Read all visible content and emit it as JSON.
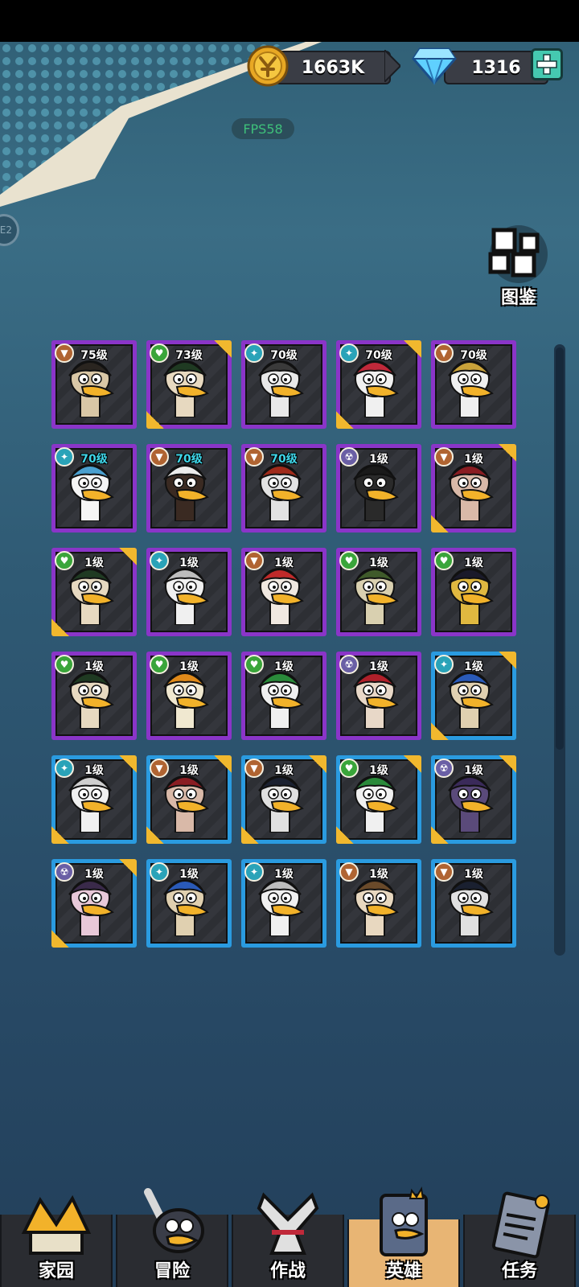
{
  "header": {
    "gold": "1663K",
    "gems": "1316",
    "fps": "FPS58",
    "side_button_text": "E2"
  },
  "codex": {
    "label": "图鉴"
  },
  "colors": {
    "purple_frame": "#8a35c8",
    "blue_frame": "#2a9be0",
    "gold_corner": "#f1b82e",
    "active_tab": "#e8b574"
  },
  "heroes": [
    {
      "level": "75级",
      "cls": "tank",
      "frame": "purple",
      "gold": false,
      "cyan": false,
      "hat": "dark",
      "face": "#d9c7a6"
    },
    {
      "level": "73级",
      "cls": "heal",
      "frame": "purple",
      "gold": true,
      "cyan": false,
      "hat": "#1f3a22",
      "face": "#e7d9c0"
    },
    {
      "level": "70级",
      "cls": "dps",
      "frame": "purple",
      "gold": false,
      "cyan": false,
      "hat": "#3a3a3a",
      "face": "#e8e8e8"
    },
    {
      "level": "70级",
      "cls": "dps",
      "frame": "purple",
      "gold": true,
      "cyan": false,
      "hat": "#c0293a",
      "face": "#f0f0f0"
    },
    {
      "level": "70级",
      "cls": "tank",
      "frame": "purple",
      "gold": false,
      "cyan": false,
      "hat": "#c9a23a",
      "face": "#efefef"
    },
    {
      "level": "70级",
      "cls": "dps",
      "frame": "purple",
      "gold": false,
      "cyan": true,
      "hat": "#4aa0d0",
      "face": "#f5f5f5"
    },
    {
      "level": "70级",
      "cls": "tank",
      "frame": "purple",
      "gold": false,
      "cyan": true,
      "hat": "#ececec",
      "face": "#3a2a22"
    },
    {
      "level": "70级",
      "cls": "tank",
      "frame": "purple",
      "gold": false,
      "cyan": true,
      "hat": "#a02a1a",
      "face": "#e2e2e2"
    },
    {
      "level": "1级",
      "cls": "mage",
      "frame": "purple",
      "gold": false,
      "cyan": false,
      "hat": "#1a1a1a",
      "face": "#2a2a2a"
    },
    {
      "level": "1级",
      "cls": "tank",
      "frame": "purple",
      "gold": true,
      "cyan": false,
      "hat": "#8a1d22",
      "face": "#d9b9a8"
    },
    {
      "level": "1级",
      "cls": "heal",
      "frame": "purple",
      "gold": true,
      "cyan": false,
      "hat": "#1f3a22",
      "face": "#e7d9c0"
    },
    {
      "level": "1级",
      "cls": "dps",
      "frame": "purple",
      "gold": false,
      "cyan": false,
      "hat": "#bdbdbd",
      "face": "#f0f0f0"
    },
    {
      "level": "1级",
      "cls": "tank",
      "frame": "purple",
      "gold": false,
      "cyan": false,
      "hat": "#c02a2a",
      "face": "#f0e8e0"
    },
    {
      "level": "1级",
      "cls": "heal",
      "frame": "purple",
      "gold": false,
      "cyan": false,
      "hat": "#3f5a2a",
      "face": "#d9d0b0"
    },
    {
      "level": "1级",
      "cls": "heal",
      "frame": "purple",
      "gold": false,
      "cyan": false,
      "hat": "#1a1a2a",
      "face": "#e0b840"
    },
    {
      "level": "1级",
      "cls": "heal",
      "frame": "purple",
      "gold": false,
      "cyan": false,
      "hat": "#1f3a22",
      "face": "#e7d9c0"
    },
    {
      "level": "1级",
      "cls": "heal",
      "frame": "purple",
      "gold": false,
      "cyan": false,
      "hat": "#e08a1a",
      "face": "#f0e8d0"
    },
    {
      "level": "1级",
      "cls": "heal",
      "frame": "purple",
      "gold": false,
      "cyan": false,
      "hat": "#2a8a3a",
      "face": "#f0f0f0"
    },
    {
      "level": "1级",
      "cls": "mage",
      "frame": "purple",
      "gold": false,
      "cyan": false,
      "hat": "#b0202a",
      "face": "#e8d8c8"
    },
    {
      "level": "1级",
      "cls": "dps",
      "frame": "blue",
      "gold": true,
      "cyan": false,
      "hat": "#2a5ab8",
      "face": "#e0d0b0"
    },
    {
      "level": "1级",
      "cls": "dps",
      "frame": "blue",
      "gold": true,
      "cyan": false,
      "hat": "#cfcfcf",
      "face": "#f0f0f0"
    },
    {
      "level": "1级",
      "cls": "tank",
      "frame": "blue",
      "gold": true,
      "cyan": false,
      "hat": "#8a1d22",
      "face": "#d9b9a8"
    },
    {
      "level": "1级",
      "cls": "tank",
      "frame": "blue",
      "gold": true,
      "cyan": false,
      "hat": "#1a2030",
      "face": "#e0e0e0"
    },
    {
      "level": "1级",
      "cls": "heal",
      "frame": "blue",
      "gold": true,
      "cyan": false,
      "hat": "#2a8a3a",
      "face": "#f0f0f0"
    },
    {
      "level": "1级",
      "cls": "mage",
      "frame": "blue",
      "gold": true,
      "cyan": false,
      "hat": "#3a2a5a",
      "face": "#5a4a7a"
    },
    {
      "level": "1级",
      "cls": "mage",
      "frame": "blue",
      "gold": true,
      "cyan": false,
      "hat": "#3a2a4a",
      "face": "#e8c8d8"
    },
    {
      "level": "1级",
      "cls": "dps",
      "frame": "blue",
      "gold": false,
      "cyan": false,
      "hat": "#2a5ab8",
      "face": "#e0d0b0"
    },
    {
      "level": "1级",
      "cls": "dps",
      "frame": "blue",
      "gold": false,
      "cyan": false,
      "hat": "#bdbdbd",
      "face": "#f0f0f0"
    },
    {
      "level": "1级",
      "cls": "tank",
      "frame": "blue",
      "gold": false,
      "cyan": false,
      "hat": "#6a4a2a",
      "face": "#e8d8c0"
    },
    {
      "level": "1级",
      "cls": "tank",
      "frame": "blue",
      "gold": false,
      "cyan": false,
      "hat": "#1a2030",
      "face": "#e0e0e0"
    }
  ],
  "nav": {
    "tabs": [
      {
        "label": "家园",
        "name": "home",
        "active": false
      },
      {
        "label": "冒险",
        "name": "adventure",
        "active": false
      },
      {
        "label": "作战",
        "name": "battle",
        "active": false
      },
      {
        "label": "英雄",
        "name": "heroes",
        "active": true
      },
      {
        "label": "任务",
        "name": "quests",
        "active": false
      }
    ]
  }
}
